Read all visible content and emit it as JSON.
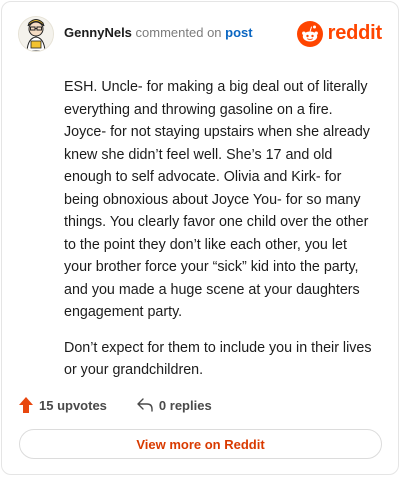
{
  "comment": {
    "author": "GennyNels",
    "action_text": "commented on",
    "post_link": "post",
    "paragraphs": [
      "ESH. Uncle- for making a big deal out of literally everything and throwing gasoline on a fire. Joyce- for not staying upstairs when she already knew she didn’t feel well. She’s 17 and old enough to self advocate. Olivia and Kirk- for being obnoxious about Joyce You- for so many things. You clearly favor one child over the other to the point they don’t like each other, you let your brother force your “sick” kid into the party, and you made a huge scene at your daughters engagement party.",
      "Don’t expect for them to include you in their lives or your grandchildren."
    ]
  },
  "brand": {
    "name": "reddit",
    "color": "#ff4500"
  },
  "actions": {
    "upvotes_label": "15 upvotes",
    "replies_label": "0 replies",
    "upvote_color": "#e8470f"
  },
  "footer": {
    "view_more_label": "View more on Reddit"
  }
}
